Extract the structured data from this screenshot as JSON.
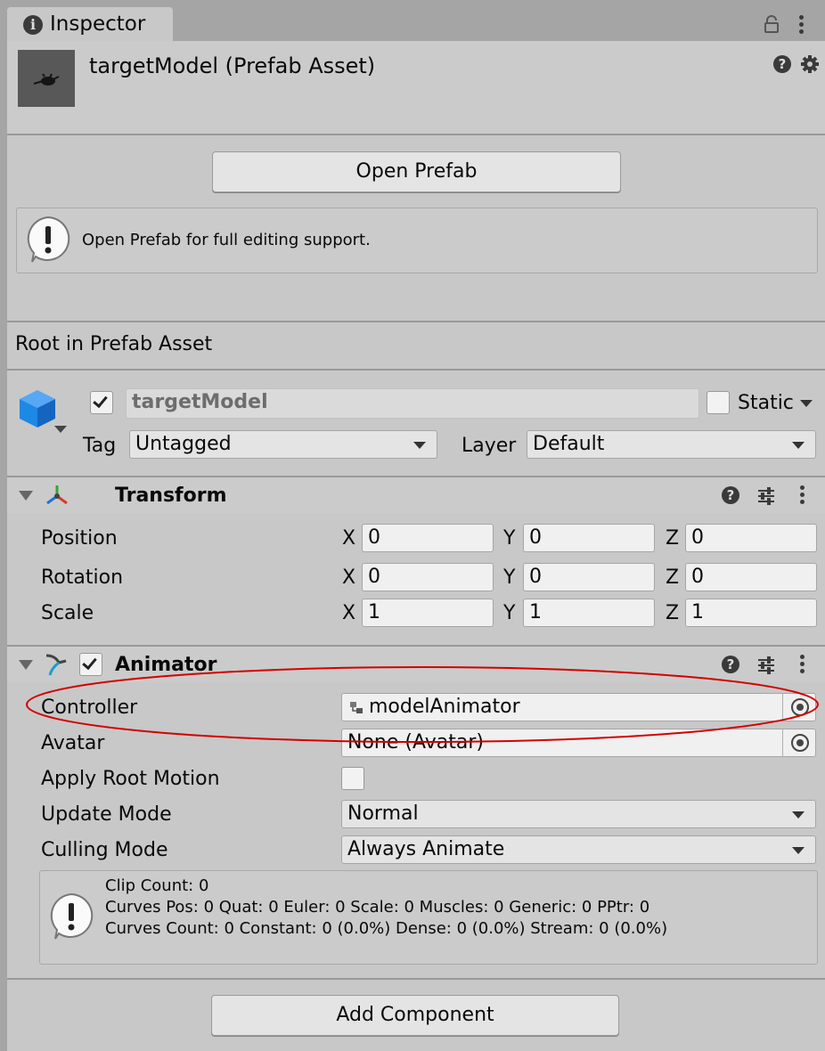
{
  "window": {
    "tab_title": "Inspector"
  },
  "header": {
    "asset_title": "targetModel (Prefab Asset)"
  },
  "prefab": {
    "open_button": "Open Prefab",
    "help_message": "Open Prefab for full editing support.",
    "root_label": "Root in Prefab Asset"
  },
  "gameobject": {
    "name": "targetModel",
    "static_label": "Static",
    "tag_label": "Tag",
    "tag_value": "Untagged",
    "layer_label": "Layer",
    "layer_value": "Default"
  },
  "transform": {
    "title": "Transform",
    "rows": [
      {
        "label": "Position",
        "x": "0",
        "y": "0",
        "z": "0"
      },
      {
        "label": "Rotation",
        "x": "0",
        "y": "0",
        "z": "0"
      },
      {
        "label": "Scale",
        "x": "1",
        "y": "1",
        "z": "1"
      }
    ],
    "axis": {
      "x": "X",
      "y": "Y",
      "z": "Z"
    }
  },
  "animator": {
    "title": "Animator",
    "controller_label": "Controller",
    "controller_value": "modelAnimator",
    "avatar_label": "Avatar",
    "avatar_value": "None (Avatar)",
    "root_motion_label": "Apply Root Motion",
    "update_mode_label": "Update Mode",
    "update_mode_value": "Normal",
    "culling_mode_label": "Culling Mode",
    "culling_mode_value": "Always Animate",
    "info": {
      "line1": "Clip Count: 0",
      "line2": "Curves Pos: 0 Quat: 0 Euler: 0 Scale: 0 Muscles: 0 Generic: 0 PPtr: 0",
      "line3": "Curves Count: 0 Constant: 0 (0.0%) Dense: 0 (0.0%) Stream: 0 (0.0%)"
    }
  },
  "footer": {
    "add_component": "Add Component"
  },
  "colors": {
    "highlight_ellipse": "#d40000",
    "cube_blue": "#1e88e5"
  }
}
